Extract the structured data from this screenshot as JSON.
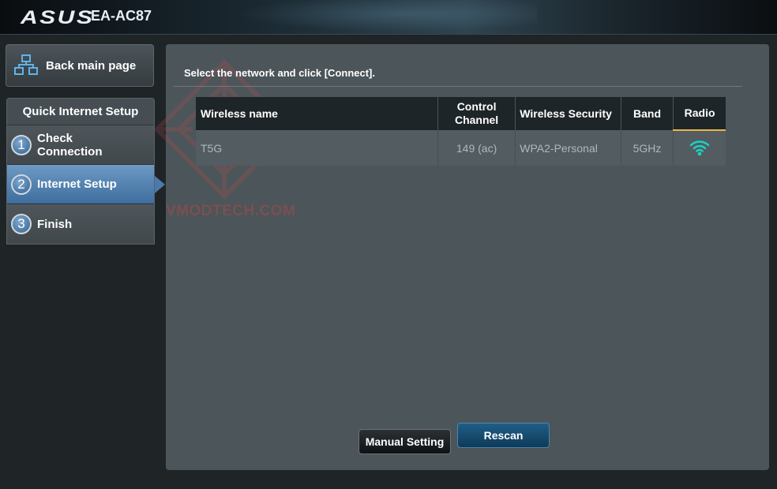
{
  "header": {
    "brand": "ASUS",
    "model": "EA-AC87"
  },
  "sidebar": {
    "back_label": "Back main page",
    "steps_title": "Quick Internet Setup",
    "steps": [
      {
        "num": "1",
        "label": "Check Connection",
        "active": false
      },
      {
        "num": "2",
        "label": "Internet Setup",
        "active": true
      },
      {
        "num": "3",
        "label": "Finish",
        "active": false
      }
    ]
  },
  "main": {
    "instruction": "Select the network and click [Connect].",
    "watermark": "VMODTECH.COM",
    "table": {
      "headers": {
        "name": "Wireless name",
        "channel": "Control Channel",
        "security": "Wireless Security",
        "band": "Band",
        "radio": "Radio"
      },
      "rows": [
        {
          "name": "T5G",
          "channel": "149 (ac)",
          "security": "WPA2-Personal",
          "band": "5GHz",
          "radio_icon": "wifi-signal-icon"
        }
      ]
    },
    "buttons": {
      "manual": "Manual Setting",
      "rescan": "Rescan"
    }
  },
  "colors": {
    "accent": "#3e6e9e",
    "radio_tab": "#e8b84a",
    "wifi_icon": "#19d3c5"
  }
}
